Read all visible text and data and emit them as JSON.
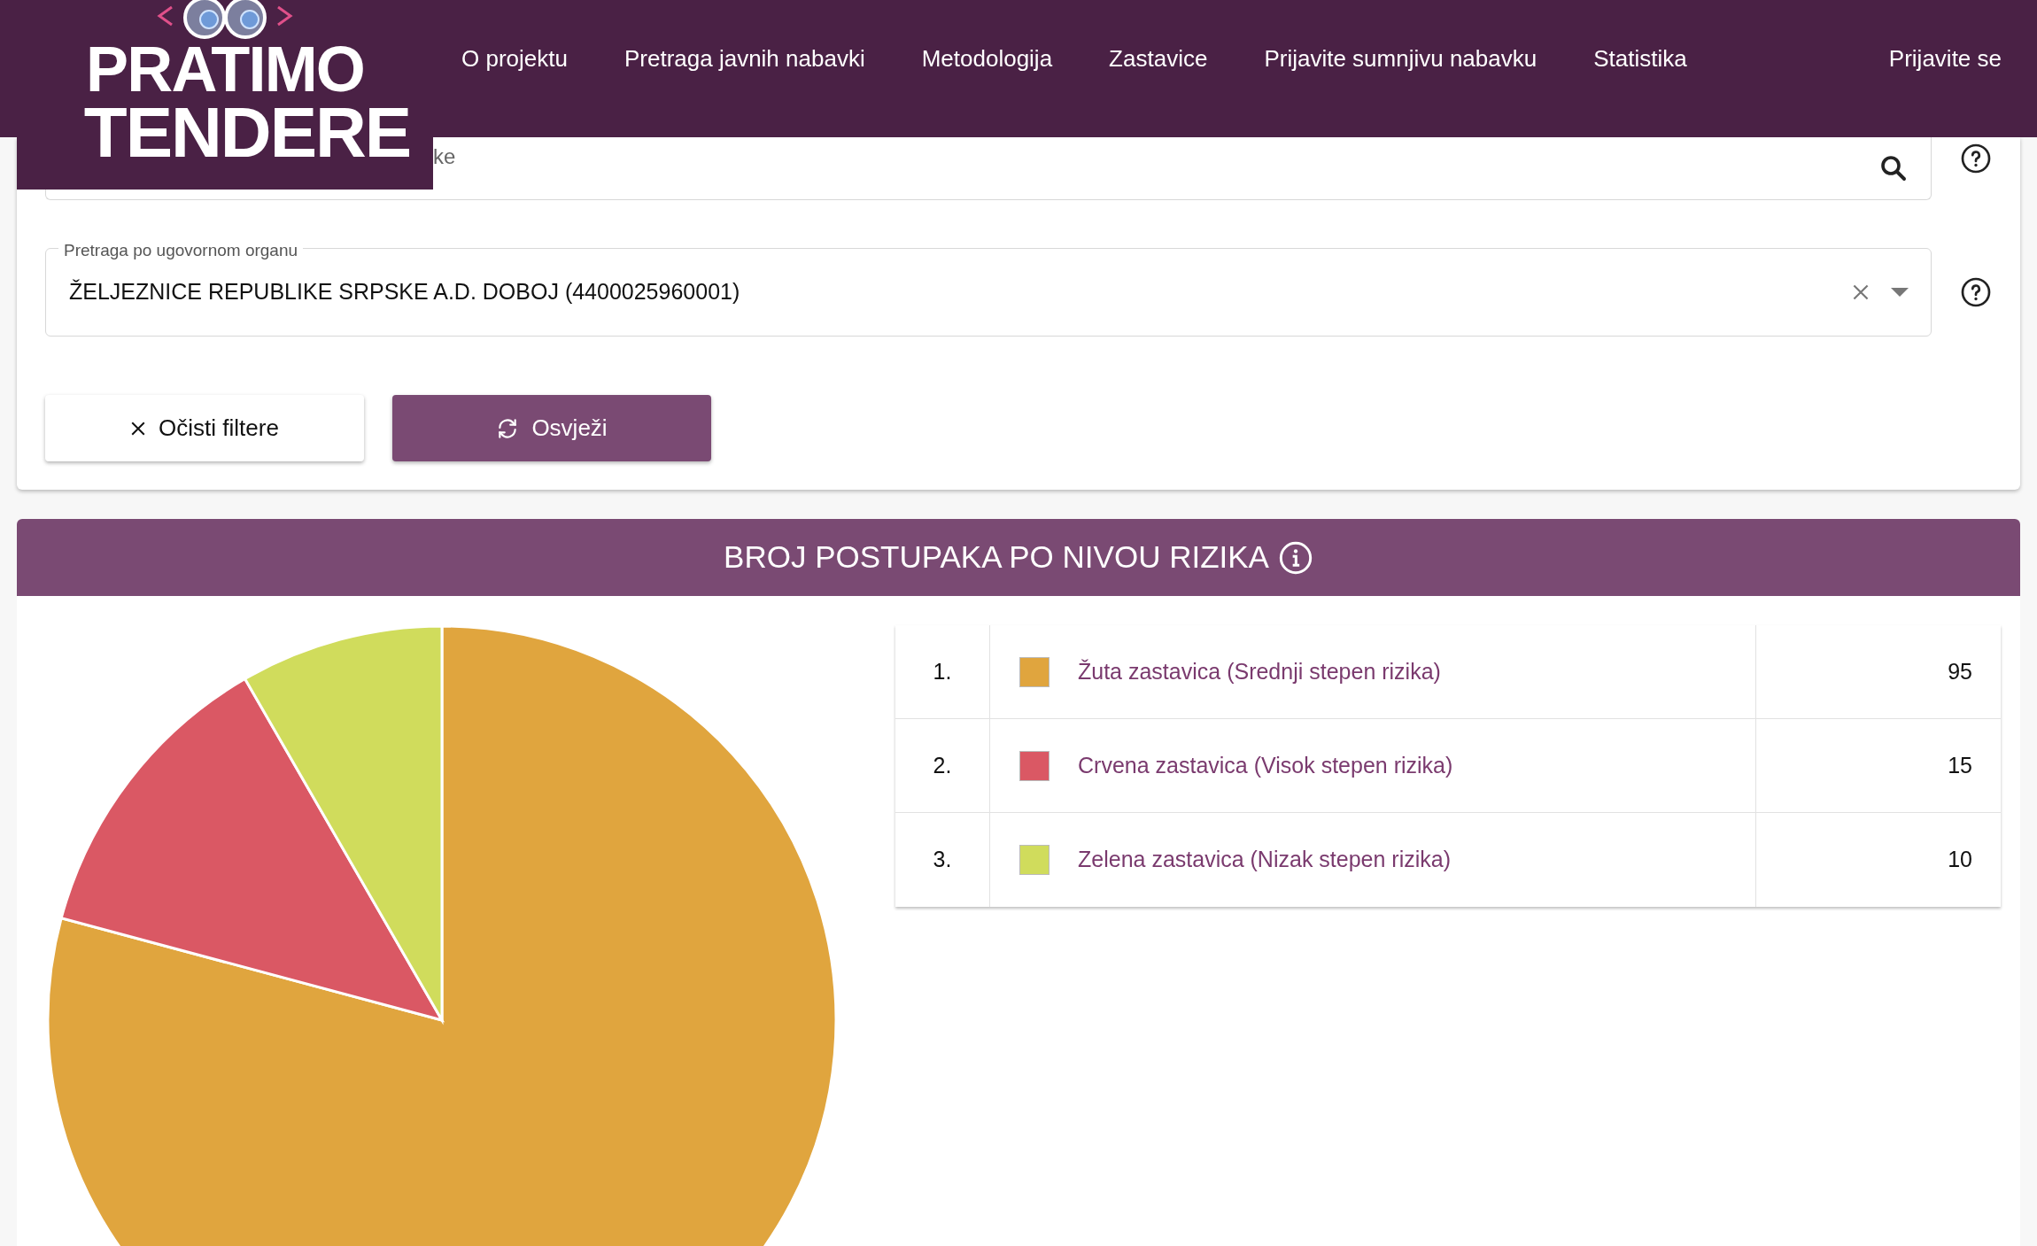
{
  "logo": {
    "line_1": "PRATIMO",
    "line_2": "TENDERE"
  },
  "nav": {
    "items": [
      {
        "label": "O projektu"
      },
      {
        "label": "Pretraga javnih nabavki"
      },
      {
        "label": "Metodologija"
      },
      {
        "label": "Zastavice"
      },
      {
        "label": "Prijavite sumnjivu nabavku"
      },
      {
        "label": "Statistika"
      }
    ],
    "login": "Prijavite se"
  },
  "filters": {
    "search_field": {
      "placeholder": "ke"
    },
    "authority_field": {
      "label": "Pretraga po ugovornom organu",
      "value": "ŽELJEZNICE REPUBLIKE SRPSKE A.D. DOBOJ (4400025960001)"
    },
    "buttons": [
      {
        "label": "Očisti filtere",
        "kind": "clear"
      },
      {
        "label": "Osvježi",
        "kind": "refresh"
      }
    ]
  },
  "risk_panel": {
    "title": "BROJ POSTUPAKA PO NIVOU RIZIKA",
    "chart_data": {
      "type": "pie",
      "categories": [
        "Žuta zastavica (Srednji stepen rizika)",
        "Crvena zastavica (Visok stepen rizika)",
        "Zelena zastavica (Nizak stepen rizika)"
      ],
      "values": [
        79.17,
        12.5,
        8.33
      ]
    },
    "rows": [
      {
        "index": "1.",
        "color": "#e0a53e",
        "count": "95"
      },
      {
        "index": "2.",
        "color": "#da5864",
        "count": "15"
      },
      {
        "index": "3.",
        "color": "#d0dc5c",
        "count": "10"
      }
    ]
  }
}
